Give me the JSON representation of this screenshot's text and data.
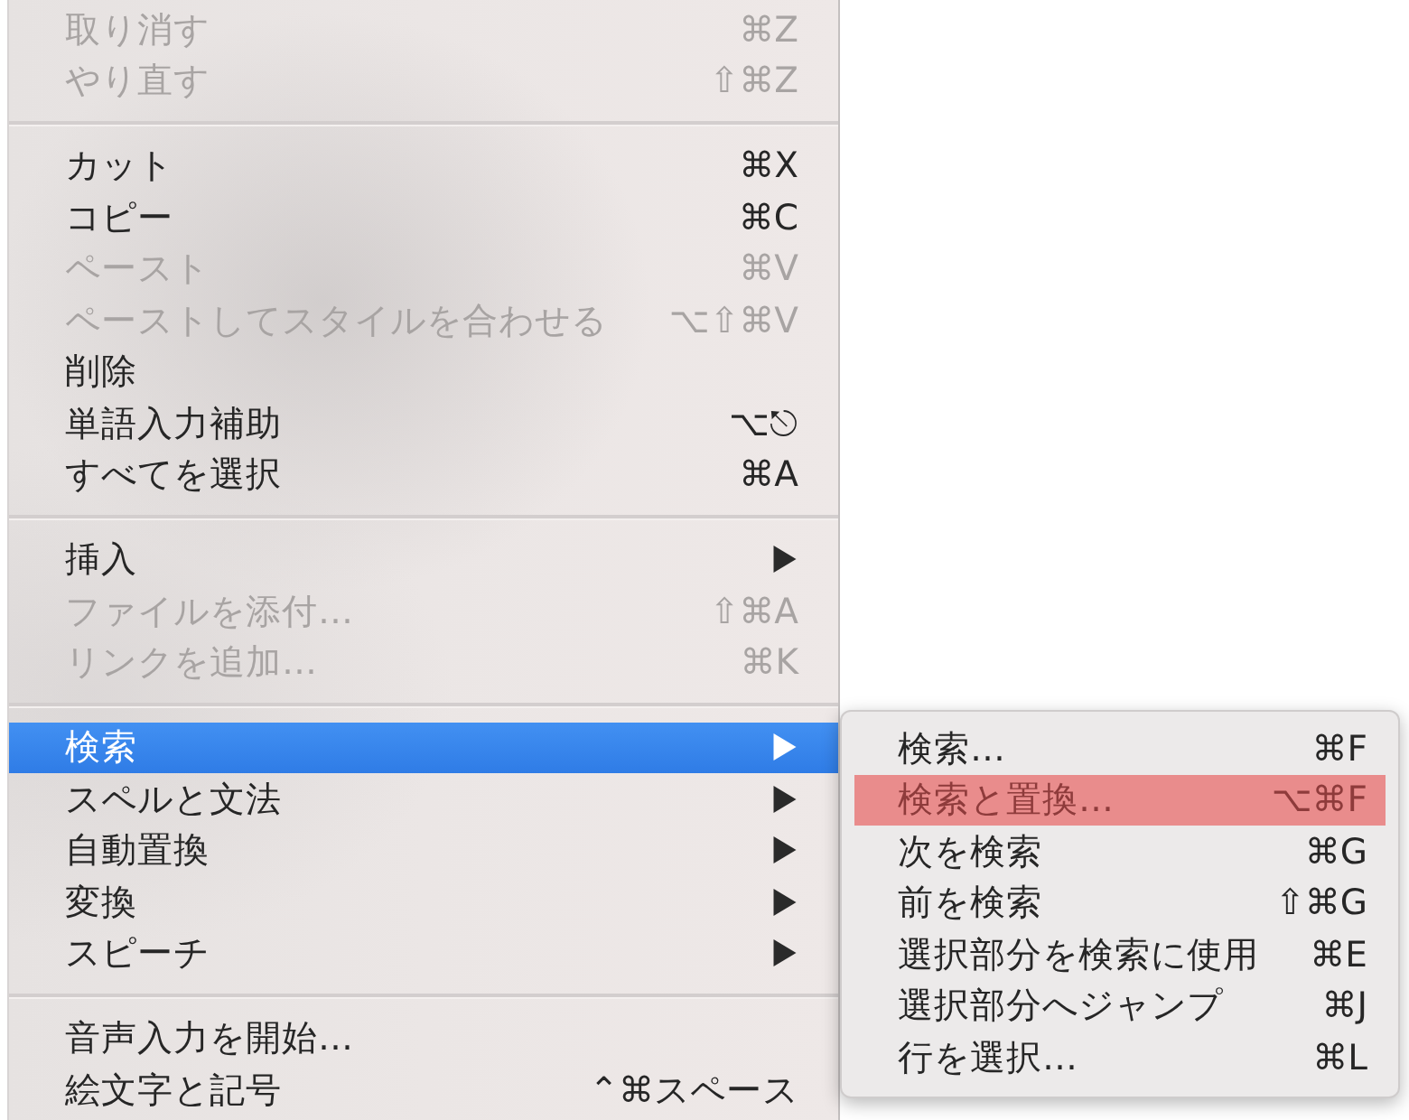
{
  "menu": {
    "sections": [
      {
        "items": [
          {
            "kind": "command",
            "label": "取り消す",
            "shortcut": "⌘Z",
            "disabled": true,
            "selected": false
          },
          {
            "kind": "command",
            "label": "やり直す",
            "shortcut": "⇧⌘Z",
            "disabled": true,
            "selected": false
          }
        ]
      },
      {
        "items": [
          {
            "kind": "command",
            "label": "カット",
            "shortcut": "⌘X",
            "disabled": false,
            "selected": false
          },
          {
            "kind": "command",
            "label": "コピー",
            "shortcut": "⌘C",
            "disabled": false,
            "selected": false
          },
          {
            "kind": "command",
            "label": "ペースト",
            "shortcut": "⌘V",
            "disabled": true,
            "selected": false
          },
          {
            "kind": "command",
            "label": "ペーストしてスタイルを合わせる",
            "shortcut": "⌥⇧⌘V",
            "disabled": true,
            "selected": false
          },
          {
            "kind": "command",
            "label": "削除",
            "disabled": false,
            "selected": false
          },
          {
            "kind": "command",
            "label": "単語入力補助",
            "shortcut": "⌥⎋",
            "disabled": false,
            "selected": false
          },
          {
            "kind": "command",
            "label": "すべてを選択",
            "shortcut": "⌘A",
            "disabled": false,
            "selected": false
          }
        ]
      },
      {
        "items": [
          {
            "kind": "submenu",
            "label": "挿入",
            "disabled": false,
            "selected": false
          },
          {
            "kind": "command",
            "label": "ファイルを添付…",
            "shortcut": "⇧⌘A",
            "disabled": true,
            "selected": false
          },
          {
            "kind": "command",
            "label": "リンクを追加…",
            "shortcut": "⌘K",
            "disabled": true,
            "selected": false
          }
        ]
      },
      {
        "items": [
          {
            "kind": "submenu",
            "label": "検索",
            "disabled": false,
            "selected": true
          },
          {
            "kind": "submenu",
            "label": "スペルと文法",
            "disabled": false,
            "selected": false
          },
          {
            "kind": "submenu",
            "label": "自動置換",
            "disabled": false,
            "selected": false
          },
          {
            "kind": "submenu",
            "label": "変換",
            "disabled": false,
            "selected": false
          },
          {
            "kind": "submenu",
            "label": "スピーチ",
            "disabled": false,
            "selected": false
          }
        ]
      },
      {
        "items": [
          {
            "kind": "command",
            "label": "音声入力を開始…",
            "disabled": false,
            "selected": false
          },
          {
            "kind": "command",
            "label": "絵文字と記号",
            "shortcut": "⌃⌘スペース",
            "disabled": false,
            "selected": false
          }
        ]
      }
    ]
  },
  "submenu": {
    "items": [
      {
        "label": "検索…",
        "shortcut": "⌘F",
        "marked": false
      },
      {
        "label": "検索と置換…",
        "shortcut": "⌥⌘F",
        "marked": true
      },
      {
        "label": "次を検索",
        "shortcut": "⌘G",
        "marked": false
      },
      {
        "label": "前を検索",
        "shortcut": "⇧⌘G",
        "marked": false
      },
      {
        "label": "選択部分を検索に使用",
        "shortcut": "⌘E",
        "marked": false
      },
      {
        "label": "選択部分へジャンプ",
        "shortcut": "⌘J",
        "marked": false
      },
      {
        "label": "行を選択…",
        "shortcut": "⌘L",
        "marked": false
      }
    ]
  }
}
